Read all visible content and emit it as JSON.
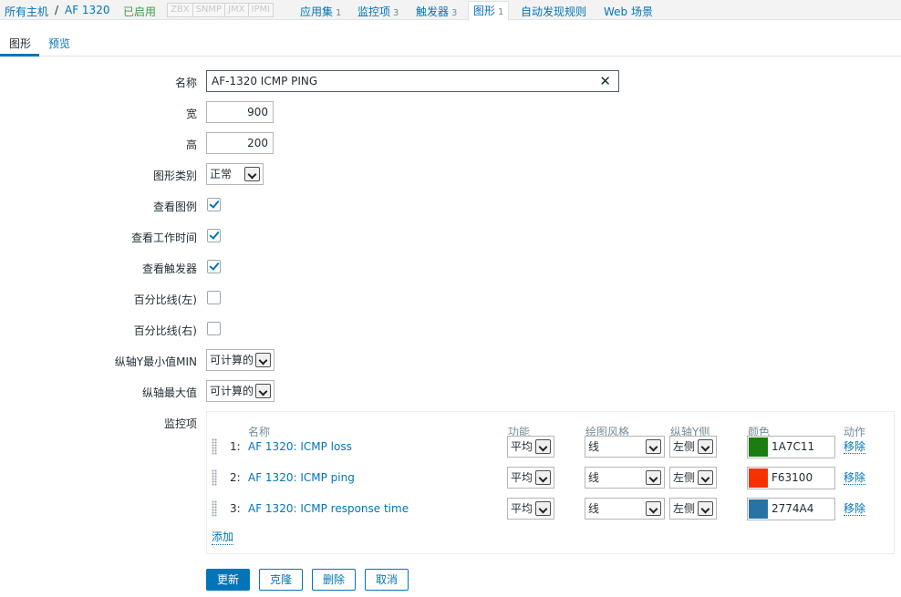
{
  "host_nav": {
    "all_hosts": "所有主机",
    "separator": "/",
    "host": "AF 1320",
    "status": "已启用",
    "protocols": [
      "ZBX",
      "SNMP",
      "JMX",
      "IPMI"
    ],
    "links": [
      {
        "label": "应用集",
        "count": "1"
      },
      {
        "label": "监控项",
        "count": "3"
      },
      {
        "label": "触发器",
        "count": "3"
      },
      {
        "label": "图形",
        "count": "1"
      },
      {
        "label": "自动发现规则",
        "count": ""
      },
      {
        "label": "Web 场景",
        "count": ""
      }
    ]
  },
  "tabs": [
    "图形",
    "预览"
  ],
  "form": {
    "name_label": "名称",
    "name_value": "AF-1320 ICMP PING",
    "width_label": "宽",
    "width_value": "900",
    "height_label": "高",
    "height_value": "200",
    "graph_type_label": "图形类别",
    "graph_type_value": "正常",
    "show_legend_label": "查看图例",
    "show_legend": true,
    "show_work_period_label": "查看工作时间",
    "show_work_period": true,
    "show_triggers_label": "查看触发器",
    "show_triggers": true,
    "percentile_left_label": "百分比线(左)",
    "percentile_left": false,
    "percentile_right_label": "百分比线(右)",
    "percentile_right": false,
    "ymin_label": "纵轴Y最小值MIN",
    "ymin_value": "可计算的",
    "ymax_label": "纵轴最大值",
    "ymax_value": "可计算的",
    "items_label": "监控项"
  },
  "items_table": {
    "headers": {
      "name": "名称",
      "function": "功能",
      "draw_style": "绘图风格",
      "y_axis": "纵轴Y侧",
      "color": "颜色",
      "action": "动作"
    },
    "rows": [
      {
        "index": "1:",
        "name": "AF 1320: ICMP loss",
        "function": "平均",
        "draw_style": "线",
        "y_axis": "左侧",
        "color": "1A7C11",
        "color_hex": "#1A7C11",
        "action": "移除"
      },
      {
        "index": "2:",
        "name": "AF 1320: ICMP ping",
        "function": "平均",
        "draw_style": "线",
        "y_axis": "左侧",
        "color": "F63100",
        "color_hex": "#F63100",
        "action": "移除"
      },
      {
        "index": "3:",
        "name": "AF 1320: ICMP response time",
        "function": "平均",
        "draw_style": "线",
        "y_axis": "左侧",
        "color": "2774A4",
        "color_hex": "#2774A4",
        "action": "移除"
      }
    ],
    "add_label": "添加"
  },
  "buttons": {
    "update": "更新",
    "clone": "克隆",
    "delete": "删除",
    "cancel": "取消"
  },
  "colors": {
    "accent": "#0275b8",
    "enabled": "#429e47"
  }
}
